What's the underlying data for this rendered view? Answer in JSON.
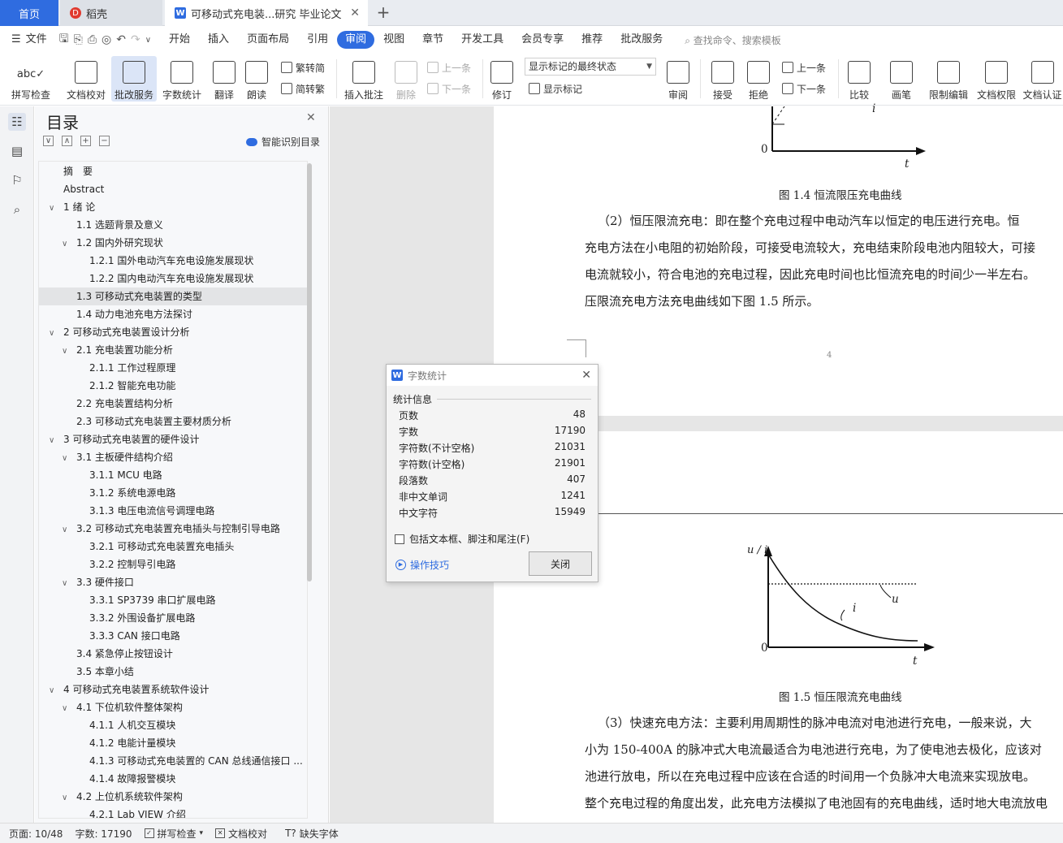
{
  "tabs": {
    "home": "首页",
    "daoke": "稻壳",
    "doc": "可移动式充电装...研究 毕业论文",
    "add": "+"
  },
  "menu": {
    "file": "文件",
    "items": [
      "开始",
      "插入",
      "页面布局",
      "引用",
      "审阅",
      "视图",
      "章节",
      "开发工具",
      "会员专享",
      "推荐",
      "批改服务"
    ],
    "active": "审阅",
    "search": "查找命令、搜索模板"
  },
  "ribbon": {
    "spell": "拼写检查",
    "proof": "文档校对",
    "grading": "批改服务",
    "wordcount": "字数统计",
    "translate": "翻译",
    "read": "朗读",
    "to_simplified": "繁转简",
    "to_traditional": "简转繁",
    "insert_comment": "插入批注",
    "delete": "删除",
    "prev": "上一条",
    "next": "下一条",
    "revise": "修订",
    "markup_dropdown": "显示标记的最终状态",
    "show_markup": "显示标记",
    "review": "审阅",
    "accept": "接受",
    "reject": "拒绝",
    "prev2": "上一条",
    "next2": "下一条",
    "compare": "比较",
    "pen": "画笔",
    "restrict": "限制编辑",
    "perm": "文档权限",
    "auth": "文档认证"
  },
  "toc": {
    "title": "目录",
    "smart": "智能识别目录",
    "items": [
      {
        "text": "摘　要",
        "level": 0,
        "toggle": ""
      },
      {
        "text": "Abstract",
        "level": 0,
        "toggle": ""
      },
      {
        "text": "1  绪  论",
        "level": 0,
        "toggle": "∨"
      },
      {
        "text": "1.1  选题背景及意义",
        "level": 1,
        "toggle": ""
      },
      {
        "text": "1.2  国内外研究现状",
        "level": 1,
        "toggle": "∨"
      },
      {
        "text": "1.2.1  国外电动汽车充电设施发展现状",
        "level": 2,
        "toggle": ""
      },
      {
        "text": "1.2.2  国内电动汽车充电设施发展现状",
        "level": 2,
        "toggle": ""
      },
      {
        "text": "1.3  可移动式充电装置的类型",
        "level": 1,
        "toggle": "",
        "selected": true
      },
      {
        "text": "1.4  动力电池充电方法探讨",
        "level": 1,
        "toggle": ""
      },
      {
        "text": "2  可移动式充电装置设计分析",
        "level": 0,
        "toggle": "∨"
      },
      {
        "text": "2.1 充电装置功能分析",
        "level": 1,
        "toggle": "∨"
      },
      {
        "text": "2.1.1  工作过程原理",
        "level": 2,
        "toggle": ""
      },
      {
        "text": "2.1.2  智能充电功能",
        "level": 2,
        "toggle": ""
      },
      {
        "text": "2.2  充电装置结构分析",
        "level": 1,
        "toggle": ""
      },
      {
        "text": "2.3  可移动式充电装置主要材质分析",
        "level": 1,
        "toggle": ""
      },
      {
        "text": "3  可移动式充电装置的硬件设计",
        "level": 0,
        "toggle": "∨"
      },
      {
        "text": "3.1  主板硬件结构介绍",
        "level": 1,
        "toggle": "∨"
      },
      {
        "text": "3.1.1 MCU 电路",
        "level": 2,
        "toggle": ""
      },
      {
        "text": "3.1.2  系统电源电路",
        "level": 2,
        "toggle": ""
      },
      {
        "text": "3.1.3 电压电流信号调理电路",
        "level": 2,
        "toggle": ""
      },
      {
        "text": "3.2  可移动式充电装置充电插头与控制引导电路",
        "level": 1,
        "toggle": "∨"
      },
      {
        "text": "3.2.1  可移动式充电装置充电插头",
        "level": 2,
        "toggle": ""
      },
      {
        "text": "3.2.2  控制导引电路",
        "level": 2,
        "toggle": ""
      },
      {
        "text": "3.3  硬件接口",
        "level": 1,
        "toggle": "∨"
      },
      {
        "text": "3.3.1 SP3739 串口扩展电路",
        "level": 2,
        "toggle": ""
      },
      {
        "text": "3.3.2  外围设备扩展电路",
        "level": 2,
        "toggle": ""
      },
      {
        "text": "3.3.3 CAN  接口电路",
        "level": 2,
        "toggle": ""
      },
      {
        "text": "3.4  紧急停止按钮设计",
        "level": 1,
        "toggle": ""
      },
      {
        "text": "3.5  本章小结",
        "level": 1,
        "toggle": ""
      },
      {
        "text": "4  可移动式充电装置系统软件设计",
        "level": 0,
        "toggle": "∨"
      },
      {
        "text": "4.1 下位机软件整体架构",
        "level": 1,
        "toggle": "∨"
      },
      {
        "text": "4.1.1  人机交互模块",
        "level": 2,
        "toggle": ""
      },
      {
        "text": "4.1.2  电能计量模块",
        "level": 2,
        "toggle": ""
      },
      {
        "text": "4.1.3 可移动式充电装置的 CAN 总线通信接口 ...",
        "level": 2,
        "toggle": ""
      },
      {
        "text": "4.1.4 故障报警模块",
        "level": 2,
        "toggle": ""
      },
      {
        "text": "4.2 上位机系统软件架构",
        "level": 1,
        "toggle": "∨"
      },
      {
        "text": "4.2.1 Lab VIEW 介绍",
        "level": 2,
        "toggle": ""
      }
    ]
  },
  "document": {
    "fig14_caption": "图 1.4  恒流限压充电曲线",
    "fig14_zero": "0",
    "fig14_t": "t",
    "fig14_i": "i",
    "para2_lines": [
      "（2）恒压限流充电：即在整个充电过程中电动汽车以恒定的电压进行充电。恒",
      "充电方法在小电阻的初始阶段，可接受电流较大，充电结束阶段电池内阻较大，可接",
      "电流就较小，符合电池的充电过程，因此充电时间也比恒流充电的时间少一半左右。",
      "压限流充电方法充电曲线如下图 1.5 所示。"
    ],
    "page_number": "4",
    "fig15_ylabel": "u / i",
    "fig15_u": "u",
    "fig15_i": "i",
    "fig15_zero": "0",
    "fig15_t": "t",
    "fig15_caption": "图 1.5  恒压限流充电曲线",
    "para3_lines": [
      "（3）快速充电方法：主要利用周期性的脉冲电流对电池进行充电，一般来说，大",
      "小为  150-400A 的脉冲式大电流最适合为电池进行充电，为了使电池去极化，应该对",
      "池进行放电，所以在充电过程中应该在合适的时间用一个负脉冲大电流来实现放电。",
      "整个充电过程的角度出发，此充电方法模拟了电池固有的充电曲线，适时地大电流放电"
    ]
  },
  "dialog": {
    "title": "字数统计",
    "group": "统计信息",
    "stats": [
      {
        "label": "页数",
        "value": "48"
      },
      {
        "label": "字数",
        "value": "17190"
      },
      {
        "label": "字符数(不计空格)",
        "value": "21031"
      },
      {
        "label": "字符数(计空格)",
        "value": "21901"
      },
      {
        "label": "段落数",
        "value": "407"
      },
      {
        "label": "非中文单词",
        "value": "1241"
      },
      {
        "label": "中文字符",
        "value": "15949"
      }
    ],
    "checkbox": "包括文本框、脚注和尾注(F)",
    "checkbox_checked": false,
    "tips": "操作技巧",
    "close": "关闭"
  },
  "status": {
    "page": "页面: 10/48",
    "words": "字数: 17190",
    "spell": "拼写检查",
    "proof": "文档校对",
    "missing_font": "缺失字体"
  },
  "colors": {
    "accent": "#2f6ce0",
    "tabbar": "#e9ecf1",
    "selected_ribbon": "#dbe5f7"
  }
}
